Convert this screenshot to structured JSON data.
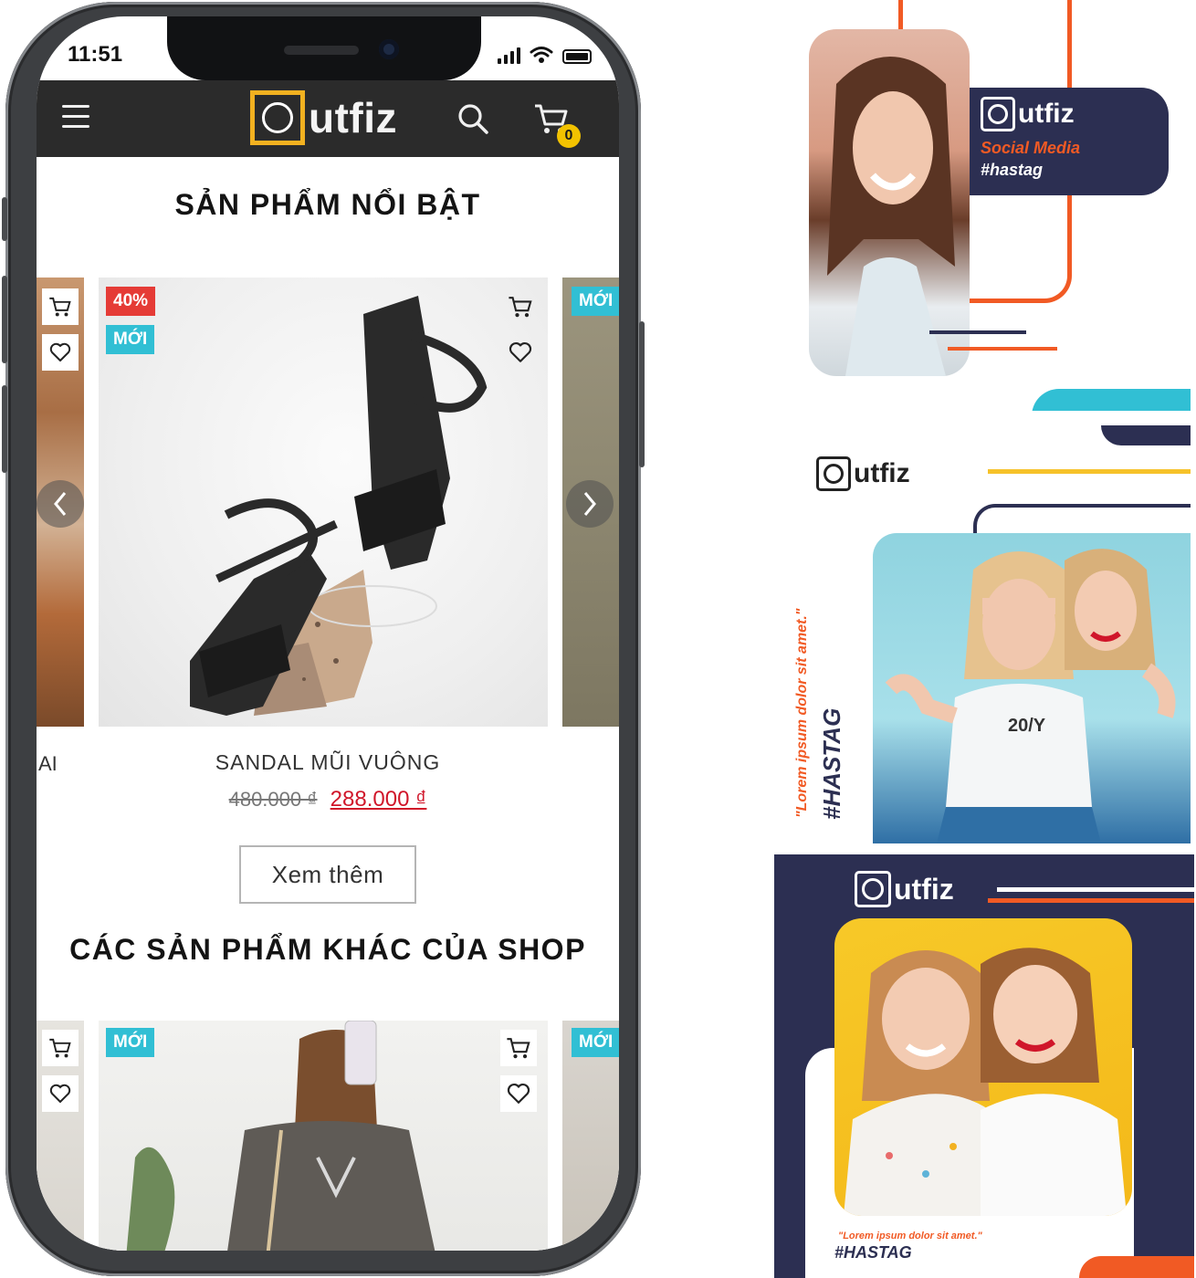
{
  "status_bar": {
    "time": "11:51"
  },
  "app": {
    "brand": "utfiz",
    "cart_count": "0"
  },
  "featured": {
    "title": "SẢN PHẨM NỔI BẬT",
    "badges": {
      "discount": "40%",
      "new": "MỚI",
      "next_new": "MỚI"
    },
    "product": {
      "name": "SANDAL MŨI VUÔNG",
      "old_price": "480.000 ₫",
      "new_price": "288.000 ₫",
      "image_icon": "sandal-photo"
    },
    "partial_prev_name": "AI",
    "more_label": "Xem thêm"
  },
  "other": {
    "title": "CÁC SẢN PHẨM KHÁC CỦA SHOP",
    "badges": {
      "new": "MỚI",
      "next_new": "MỚI"
    }
  },
  "promo_panels": {
    "panel1": {
      "brand": "utfiz",
      "line1": "Social Media",
      "line2": "#hastag"
    },
    "panel2": {
      "brand": "utfiz",
      "quote": "\"Lorem ipsum dolor sit amet.\"",
      "tag": "#HASTAG",
      "shirt_text": "20/Y"
    },
    "panel3": {
      "brand": "utfiz",
      "quote": "\"Lorem ipsum dolor sit amet.\"",
      "tag": "#HASTAG"
    }
  },
  "colors": {
    "accent_yellow": "#f2b120",
    "navy": "#2c2f52",
    "orange": "#f15a24",
    "cyan": "#31bfd4",
    "sale_red": "#e53b36",
    "price_red": "#d0162a"
  }
}
